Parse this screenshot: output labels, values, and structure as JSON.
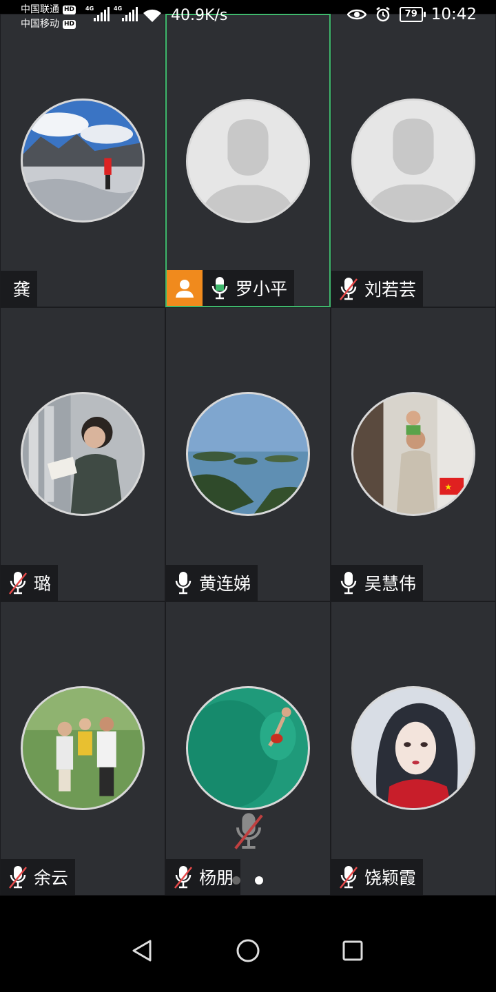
{
  "status_bar": {
    "carrier1": "中国联通",
    "carrier2": "中国移动",
    "hd": "HD",
    "network": "4G",
    "speed": "40.9K/s",
    "battery": "79",
    "time": "10:42"
  },
  "participants": [
    {
      "name": "龚",
      "mic": "none",
      "avatar": "photo-glacier"
    },
    {
      "name": "罗小平",
      "mic": "on",
      "avatar": "default",
      "host": true,
      "active": true
    },
    {
      "name": "刘若芸",
      "mic": "muted",
      "avatar": "default"
    },
    {
      "name": "璐",
      "mic": "muted",
      "avatar": "photo-reading"
    },
    {
      "name": "黄连娣",
      "mic": "on",
      "avatar": "photo-lake"
    },
    {
      "name": "吴慧伟",
      "mic": "on",
      "avatar": "photo-father-child"
    },
    {
      "name": "余云",
      "mic": "muted",
      "avatar": "photo-family"
    },
    {
      "name": "杨朋",
      "mic": "muted",
      "avatar": "photo-swimmer"
    },
    {
      "name": "饶颖霞",
      "mic": "muted",
      "avatar": "photo-illustration"
    }
  ],
  "colors": {
    "tile_bg": "#2d2f33",
    "active_border": "#3fb96d",
    "host_badge": "#f08a1d",
    "mic_on": "#3fb96d",
    "mic_muted_slash": "#e84a4a"
  },
  "pager": {
    "pages": 2,
    "current": 2
  },
  "nav": {
    "back": "back-icon",
    "home": "home-icon",
    "recents": "recents-icon"
  }
}
